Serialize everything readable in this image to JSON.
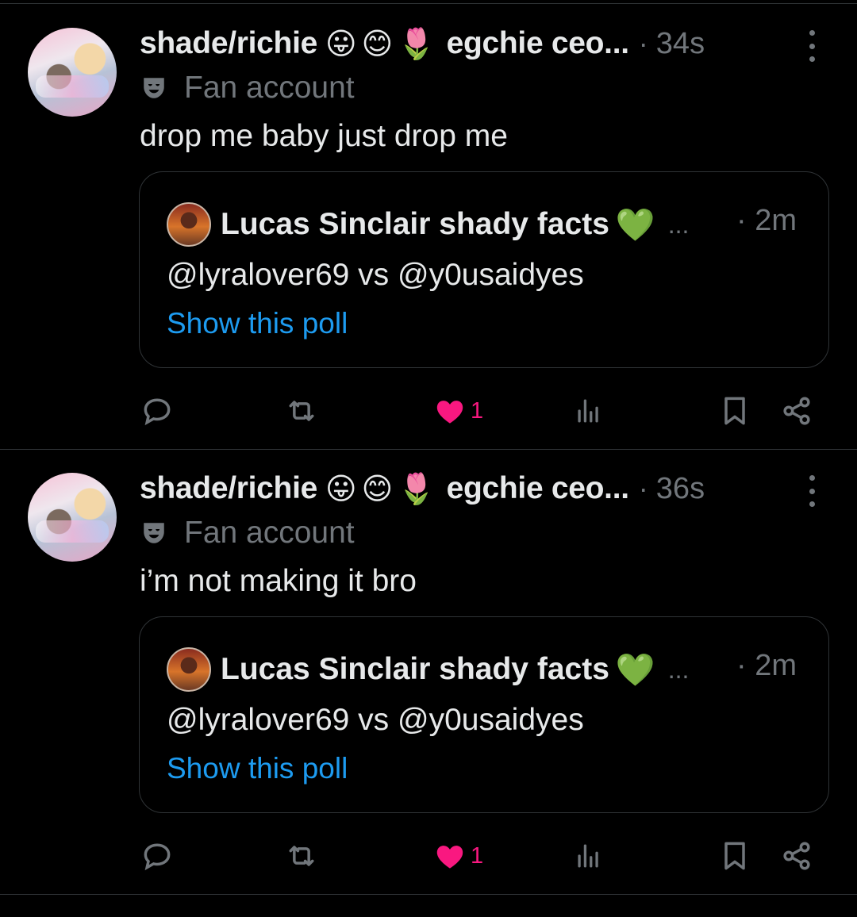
{
  "tweets": [
    {
      "author": "shade/richie",
      "emojis": [
        "😛",
        "😊",
        "🌷"
      ],
      "handle": "egchie ceo...",
      "separator": "·",
      "time": "34s",
      "label": "Fan account",
      "text": "drop me baby just drop me",
      "quote": {
        "author": "Lucas Sinclair shady facts",
        "heart": "💚",
        "ellipsis": "...",
        "time": "· 2m",
        "text": "@lyralover69 vs @y0usaidyes",
        "link": "Show this poll"
      },
      "likes": "1"
    },
    {
      "author": "shade/richie",
      "emojis": [
        "😛",
        "😊",
        "🌷"
      ],
      "handle": "egchie ceo...",
      "separator": "·",
      "time": "36s",
      "label": "Fan account",
      "text": "i’m not making it bro",
      "quote": {
        "author": "Lucas Sinclair shady facts",
        "heart": "💚",
        "ellipsis": "...",
        "time": "· 2m",
        "text": "@lyralover69 vs @y0usaidyes",
        "link": "Show this poll"
      },
      "likes": "1"
    }
  ],
  "icons": {
    "reply": "reply-icon",
    "retweet": "retweet-icon",
    "like": "heart-icon",
    "views": "views-icon",
    "bookmark": "bookmark-icon",
    "share": "share-icon",
    "more": "more-icon",
    "label": "theater-mask-icon"
  },
  "colors": {
    "background": "#000000",
    "text": "#e7e9ea",
    "muted": "#71767b",
    "link": "#1d9bf0",
    "like": "#f91880",
    "heart_green": "#1fce6d",
    "border": "#2f3336"
  }
}
